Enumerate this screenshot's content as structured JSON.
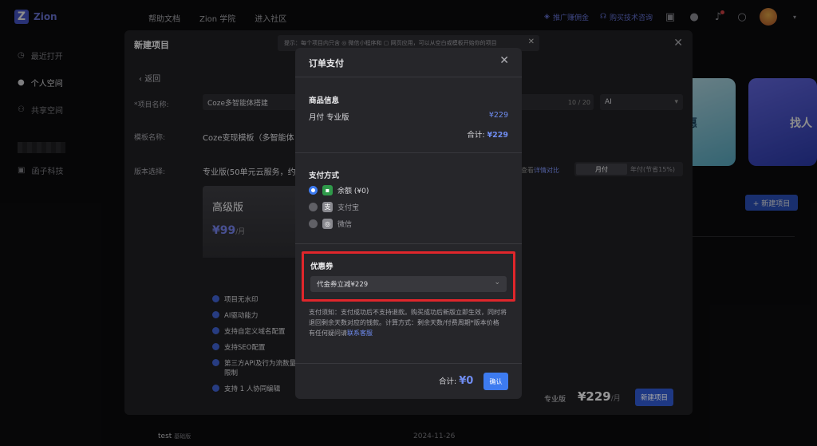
{
  "topbar": {
    "logo_text": "Zion",
    "nav": [
      "帮助文档",
      "Zion 学院",
      "进入社区"
    ],
    "promo_label": "推广赚佣金",
    "support_label": "购买技术咨询"
  },
  "sidebar": {
    "items": [
      {
        "label": "最近打开",
        "icon": "clock-icon"
      },
      {
        "label": "个人空间",
        "icon": "user-icon"
      },
      {
        "label": "共享空间",
        "icon": "users-icon"
      },
      {
        "label": "函子科技",
        "icon": "org-icon"
      }
    ]
  },
  "background": {
    "card1_text": "惠",
    "card2_text": "找人",
    "new_project_label": "+ 新建项目",
    "row_name": "test",
    "row_tag": "基础版",
    "row_date": "2024-11-26"
  },
  "project_modal": {
    "title": "新建项目",
    "tip": "提示：每个项目内只含 ◎ 微信小程序和 ▢ 网页应用，可以从空白或模板开始你的项目",
    "back_label": "返回",
    "name_label": "*项目名称:",
    "name_value": "Coze多智能体搭建",
    "name_count": "10 / 20",
    "lang_value": "AI",
    "template_label": "模板名称:",
    "template_value": "Coze变现模板（多智能体",
    "version_label": "版本选择:",
    "version_value": "专业版(50单元云服务，约",
    "compare_prefix": "查看",
    "compare_link": "详情对比",
    "billing": {
      "monthly": "月付",
      "yearly": "年付(节省15%)"
    },
    "plan": {
      "name": "高级版",
      "price": "¥99",
      "unit": "/月",
      "features": [
        "项目无水印",
        "AI驱动能力",
        "支持自定义域名配置",
        "支持SEO配置",
        "第三方API及行为流数量限制",
        "支持 1 人协同编辑"
      ]
    },
    "footer_version": "专业版",
    "footer_price": "¥229",
    "footer_unit": "/月",
    "create_button": "新建项目"
  },
  "payment": {
    "title": "订单支付",
    "product_section": "商品信息",
    "product_name": "月付 专业版",
    "product_price": "¥229",
    "subtotal_label": "合计:",
    "subtotal_value": "¥229",
    "method_section": "支付方式",
    "methods": [
      {
        "label": "余额 (¥0)",
        "selected": true,
        "icon": "wallet-icon",
        "color": "#2f9a4a"
      },
      {
        "label": "支付宝",
        "selected": false,
        "icon": "alipay-icon",
        "color": "#9a9aa0"
      },
      {
        "label": "微信",
        "selected": false,
        "icon": "wechat-icon",
        "color": "#9a9aa0"
      }
    ],
    "coupon_section": "优惠券",
    "coupon_value": "代金券立减¥229",
    "notice": "支付须知：支付成功后不支持退款。购买成功后新版立即生效，同时将退回剩余天数对应的钱款。计算方式：剩余天数/付费周期*版本价格",
    "contact_prefix": "有任何疑问请",
    "contact_link": "联系客服",
    "total_label": "合计:",
    "total_value": "¥0",
    "confirm_label": "确认"
  }
}
